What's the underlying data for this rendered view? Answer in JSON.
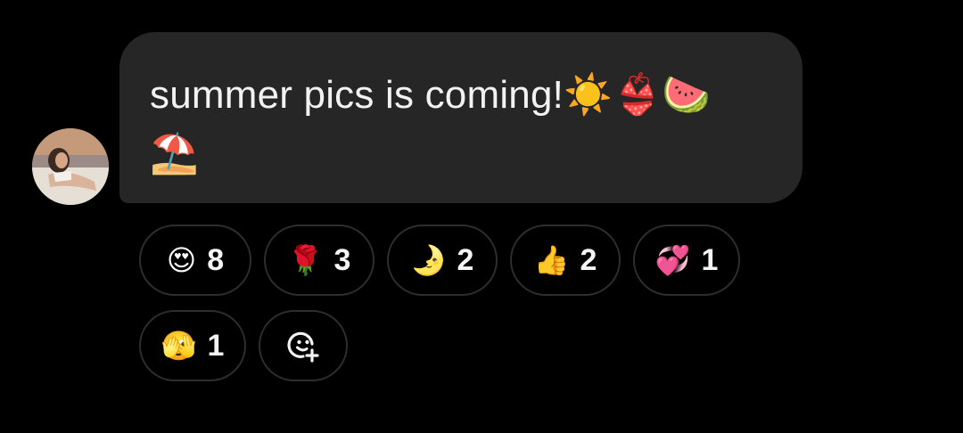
{
  "message": {
    "text": "summer pics is coming!☀️👙🍉\n⛱️"
  },
  "reactions": [
    {
      "emoji": "😍",
      "count": "8"
    },
    {
      "emoji": "🌹",
      "count": "3"
    },
    {
      "emoji": "🌛",
      "count": "2"
    },
    {
      "emoji": "👍",
      "count": "2"
    },
    {
      "emoji": "💞",
      "count": "1"
    },
    {
      "emoji": "🫣",
      "count": "1"
    }
  ],
  "add_reaction_icon": "add-emoji-reaction-icon",
  "colors": {
    "background": "#000000",
    "bubble": "#262626",
    "pill_border": "#2e2e2e",
    "text": "#f2f2f2"
  }
}
